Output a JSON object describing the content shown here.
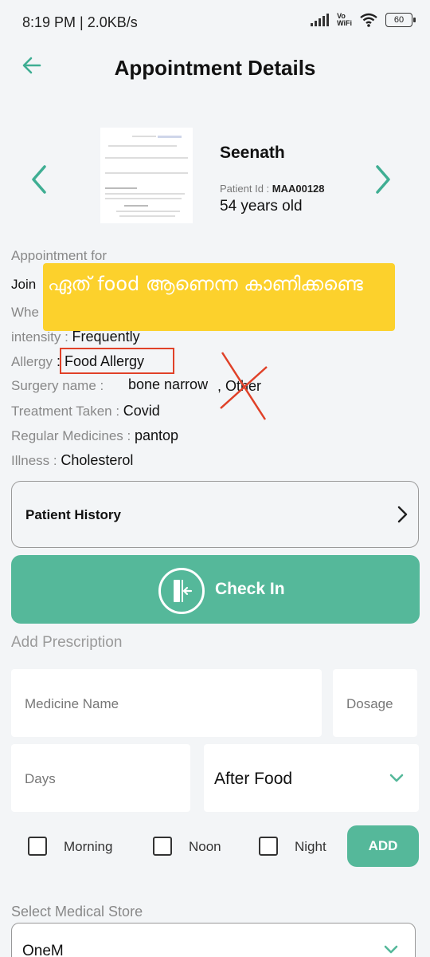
{
  "status_bar": {
    "time": "8:19 PM | 2.0KB/s",
    "network": "Vo\nWiFi",
    "battery": "60"
  },
  "header": {
    "title": "Appointment Details"
  },
  "patient": {
    "name": "Seenath",
    "id_label": "Patient Id : ",
    "id_value": "MAA00128",
    "age": "54 years old"
  },
  "details": {
    "appointment_label": "Appointment for",
    "join_partial": "Join",
    "when_partial": "Whe",
    "intensity_label": "intensity : ",
    "intensity_value": "Frequently",
    "allergy_label": "Allergy",
    "allergy_sep": " : ",
    "allergy_value": "Food Allergy",
    "surgery_label": "Surgery name : ",
    "surgery_value": "bone narrow",
    "surgery_extra": ", Other",
    "treatment_label": "Treatment Taken : ",
    "treatment_value": "Covid",
    "medicines_label": "Regular Medicines : ",
    "medicines_value": "pantop",
    "illness_label": "Illness : ",
    "illness_value": "Cholesterol"
  },
  "annotation": {
    "note": "ഏത് food ആണെന്ന കാണിക്കണ്ടെ"
  },
  "history": {
    "label": "Patient History"
  },
  "checkin": {
    "label": "Check In"
  },
  "prescription": {
    "section_title": "Add Prescription",
    "medicine_placeholder": "Medicine Name",
    "dosage_placeholder": "Dosage",
    "days_placeholder": "Days",
    "food_timing_value": "After Food",
    "morning_label": "Morning",
    "noon_label": "Noon",
    "night_label": "Night",
    "add_label": "ADD"
  },
  "store": {
    "section_title": "Select Medical Store",
    "selected_value": "OneM"
  },
  "colors": {
    "accent": "#55b89a",
    "annotation_bg": "#fcd12c",
    "annotation_red": "#e04128"
  }
}
